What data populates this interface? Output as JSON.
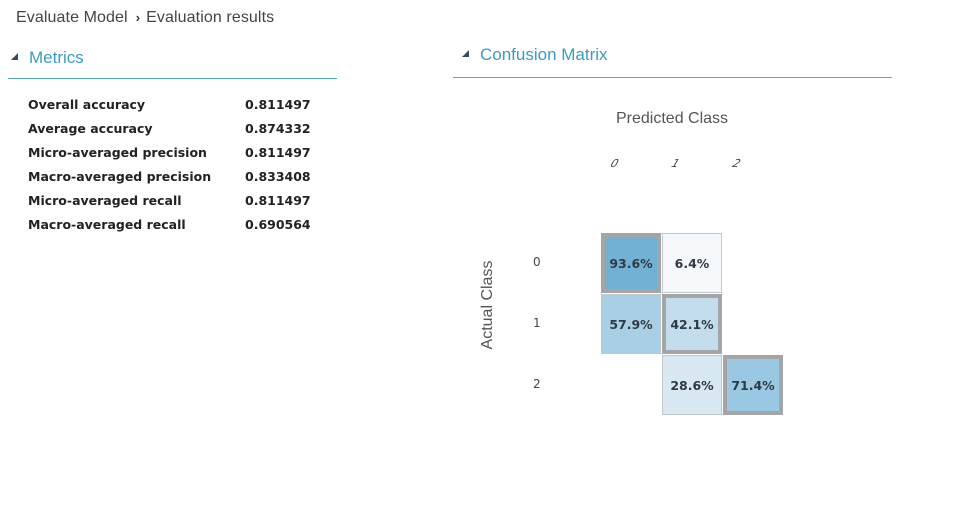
{
  "breadcrumb": {
    "parent": "Evaluate Model",
    "separator_icon": "chevron-right-icon",
    "current": "Evaluation results"
  },
  "metrics": {
    "title": "Metrics",
    "collapse_icon": "triangle-expanded-icon",
    "rows": [
      {
        "name": "Overall accuracy",
        "value": "0.811497"
      },
      {
        "name": "Average accuracy",
        "value": "0.874332"
      },
      {
        "name": "Micro-averaged precision",
        "value": "0.811497"
      },
      {
        "name": "Macro-averaged precision",
        "value": "0.833408"
      },
      {
        "name": "Micro-averaged recall",
        "value": "0.811497"
      },
      {
        "name": "Macro-averaged recall",
        "value": "0.690564"
      }
    ]
  },
  "confusion_matrix": {
    "title": "Confusion Matrix",
    "collapse_icon": "triangle-expanded-icon",
    "x_title": "Predicted Class",
    "y_title": "Actual Class",
    "col_labels": [
      "0",
      "1",
      "2"
    ],
    "row_labels": [
      "0",
      "1",
      "2"
    ]
  },
  "chart_data": {
    "type": "heatmap",
    "title": "Confusion Matrix",
    "xlabel": "Predicted Class",
    "ylabel": "Actual Class",
    "x_categories": [
      "0",
      "1",
      "2"
    ],
    "y_categories": [
      "0",
      "1",
      "2"
    ],
    "cells": [
      {
        "row": 0,
        "col": 0,
        "value": 93.6,
        "label": "93.6%",
        "diagonal": true,
        "color": "#72b1d4"
      },
      {
        "row": 0,
        "col": 1,
        "value": 6.4,
        "label": "6.4%",
        "diagonal": false,
        "color": "#f6f9fc"
      },
      {
        "row": 1,
        "col": 0,
        "value": 57.9,
        "label": "57.9%",
        "diagonal": false,
        "color": "#a9cfe4"
      },
      {
        "row": 1,
        "col": 1,
        "value": 42.1,
        "label": "42.1%",
        "diagonal": true,
        "color": "#c3dded"
      },
      {
        "row": 2,
        "col": 1,
        "value": 28.6,
        "label": "28.6%",
        "diagonal": false,
        "color": "#d8e9f3"
      },
      {
        "row": 2,
        "col": 2,
        "value": 71.4,
        "label": "71.4%",
        "diagonal": true,
        "color": "#9ac8e3"
      }
    ],
    "value_unit": "percent of actual class"
  }
}
